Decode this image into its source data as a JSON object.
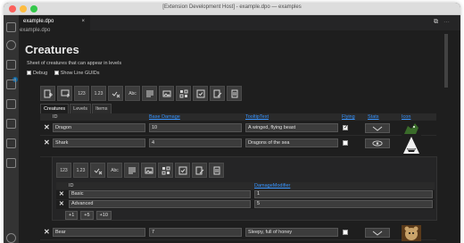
{
  "window": {
    "title": "[Extension Development Host] - example.dpo — examples"
  },
  "tab": {
    "label": "example.dpo",
    "close": "×"
  },
  "breadcrumb": "example.dpo",
  "page": {
    "title": "Creatures",
    "description": "Sheet of creatures that can appear in levels",
    "debug_label": "Debug",
    "line_guids_label": "Show Line GUIDs"
  },
  "toolbar": {
    "buttons": [
      "add-row",
      "add-column",
      "123",
      "1.23",
      "check",
      "Abc",
      "text",
      "image",
      "color",
      "checklist",
      "edit",
      "reference"
    ],
    "labels": {
      "int": "123",
      "float": "1.23",
      "abc": "Abc"
    }
  },
  "sheet_tabs": [
    "Creatures",
    "Levels",
    "Items"
  ],
  "columns": {
    "id": "ID",
    "base_damage": "Base Damage",
    "tooltip": "TooltipText",
    "flying": "Flying",
    "stats": "Stats",
    "icon": "Icon"
  },
  "rows": [
    {
      "id": "Dragon",
      "base_damage": "10",
      "tooltip": "A winged, flying beast",
      "flying": true
    },
    {
      "id": "Shark",
      "base_damage": "4",
      "tooltip": "Dragons of the sea",
      "flying": false
    },
    {
      "id": "Bear",
      "base_damage": "7",
      "tooltip": "Sleepy, full of honey",
      "flying": false
    }
  ],
  "nested": {
    "columns": {
      "id": "ID",
      "damage_modifier": "DamageModifier"
    },
    "rows": [
      {
        "id": "Basic",
        "damage_modifier": "1"
      },
      {
        "id": "Advanced",
        "damage_modifier": "5"
      }
    ],
    "step_buttons": [
      "+1",
      "+5",
      "+10"
    ]
  },
  "colors": {
    "accent": "#3794ff",
    "background": "#1e1e1e",
    "activity_bar": "#333333"
  }
}
